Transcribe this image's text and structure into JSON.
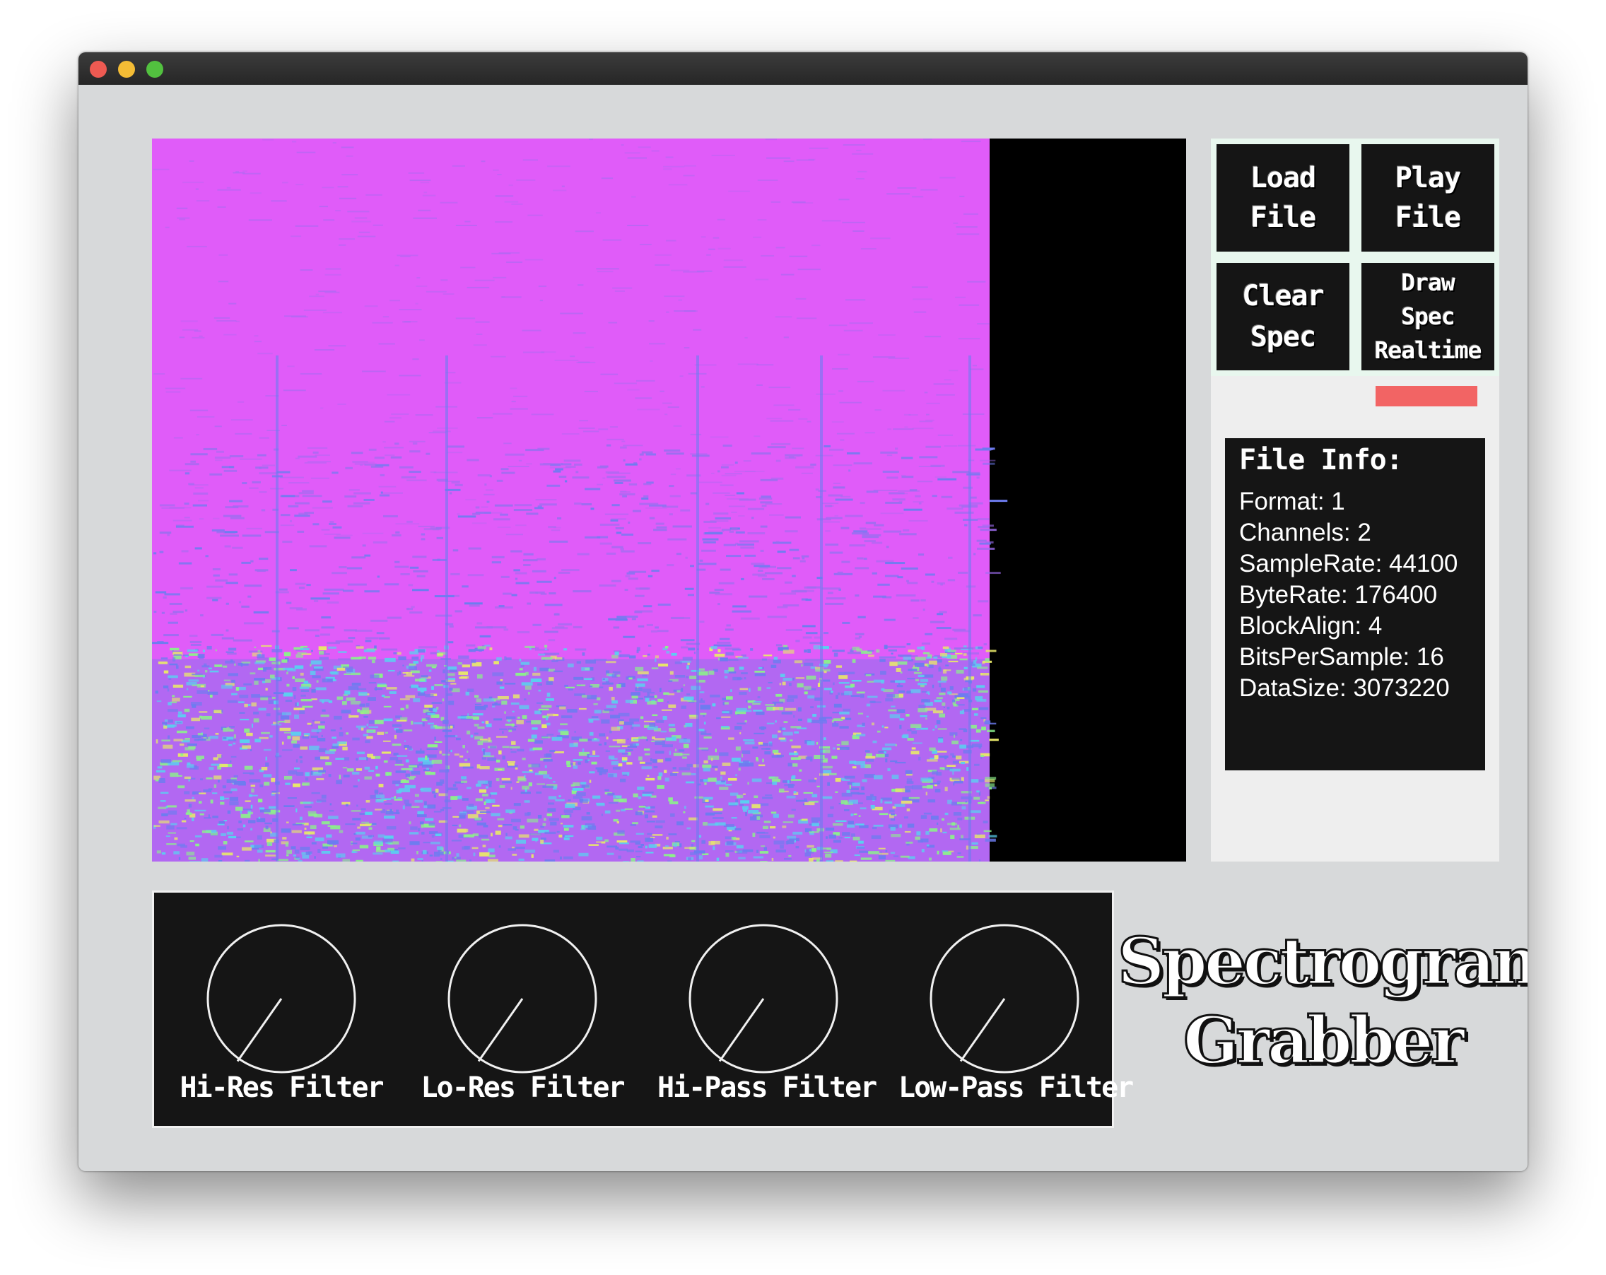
{
  "window": {
    "traffic_lights": [
      "close",
      "minimize",
      "zoom"
    ],
    "colors": {
      "red": "#ee5a52",
      "yellow": "#f4bc35",
      "green": "#52c13f"
    }
  },
  "spectrogram": {
    "colors": {
      "background": "#e05cf9",
      "mid": "#9e6df0",
      "low": "#6d7cf0",
      "cyan": "#5ad0f0",
      "green": "#8cf08c",
      "yellow": "#e8e86a",
      "empty": "#000000"
    },
    "filled_fraction": 0.81
  },
  "buttons": {
    "load_file": "Load\nFile",
    "play_file": "Play\nFile",
    "clear_spec": "Clear\nSpec",
    "draw_spec_realtime": "Draw\nSpec\nRealtime"
  },
  "indicator": {
    "color": "#f26464"
  },
  "file_info": {
    "title": "File Info:",
    "rows": [
      "Format: 1",
      "Channels: 2",
      "SampleRate: 44100",
      "ByteRate: 176400",
      "BlockAlign: 4",
      "BitsPerSample: 16",
      "DataSize: 3073220"
    ]
  },
  "knobs": [
    {
      "label": "Hi-Res Filter",
      "value": 0.0
    },
    {
      "label": "Lo-Res Filter",
      "value": 0.0
    },
    {
      "label": "Hi-Pass Filter",
      "value": 0.0
    },
    {
      "label": "Low-Pass Filter",
      "value": 0.0
    }
  ],
  "brand": {
    "line1": "Spectrogram",
    "line2": "Grabber"
  }
}
